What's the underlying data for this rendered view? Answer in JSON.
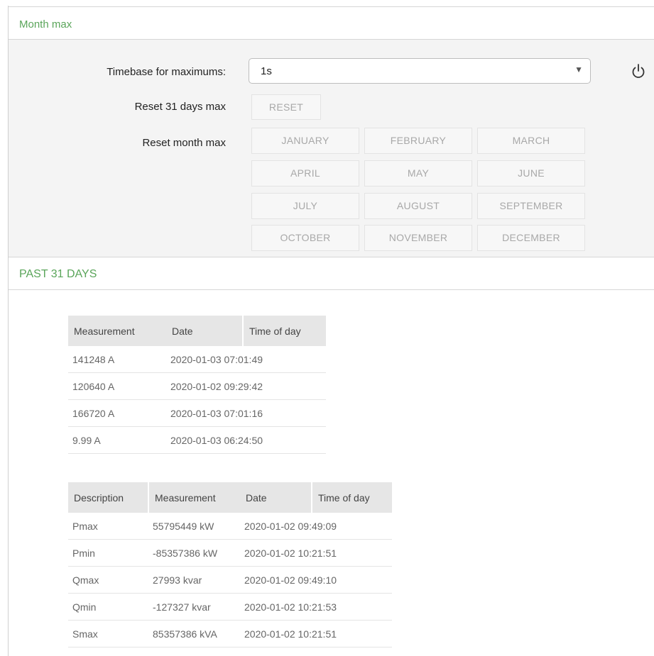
{
  "month_max": {
    "title": "Month max",
    "timebase_label": "Timebase for maximums:",
    "timebase_value": "1s",
    "reset31_label": "Reset 31 days max",
    "reset_button": "RESET",
    "reset_month_label": "Reset month max",
    "months": [
      "JANUARY",
      "FEBRUARY",
      "MARCH",
      "APRIL",
      "MAY",
      "JUNE",
      "JULY",
      "AUGUST",
      "SEPTEMBER",
      "OCTOBER",
      "NOVEMBER",
      "DECEMBER"
    ]
  },
  "past31": {
    "title": "PAST 31 DAYS",
    "table1": {
      "headers": [
        "Measurement",
        "Date",
        "Time of day"
      ],
      "rows": [
        [
          "141248 A",
          "2020-01-03",
          "07:01:49"
        ],
        [
          "120640 A",
          "2020-01-02",
          "09:29:42"
        ],
        [
          "166720 A",
          "2020-01-03",
          "07:01:16"
        ],
        [
          "9.99 A",
          "2020-01-03",
          "06:24:50"
        ]
      ]
    },
    "table2": {
      "headers": [
        "Description",
        "Measurement",
        "Date",
        "Time of day"
      ],
      "rows": [
        [
          "Pmax",
          "55795449 kW",
          "2020-01-02",
          "09:49:09"
        ],
        [
          "Pmin",
          "-85357386 kW",
          "2020-01-02",
          "10:21:51"
        ],
        [
          "Qmax",
          "27993 kvar",
          "2020-01-02",
          "09:49:10"
        ],
        [
          "Qmin",
          "-127327 kvar",
          "2020-01-02",
          "10:21:53"
        ],
        [
          "Smax",
          "85357386 kVA",
          "2020-01-02",
          "10:21:51"
        ]
      ]
    }
  }
}
